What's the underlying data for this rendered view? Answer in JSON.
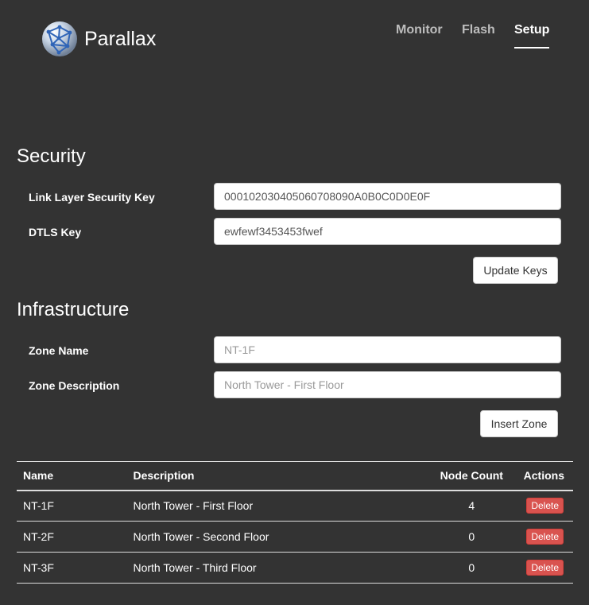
{
  "app": {
    "brand": "Parallax",
    "logo_icon": "globe-network-icon"
  },
  "nav": {
    "items": [
      {
        "label": "Monitor",
        "active": false
      },
      {
        "label": "Flash",
        "active": false
      },
      {
        "label": "Setup",
        "active": true
      }
    ]
  },
  "security": {
    "title": "Security",
    "link_layer_key_label": "Link Layer Security Key",
    "link_layer_key_value": "000102030405060708090A0B0C0D0E0F",
    "dtls_key_label": "DTLS Key",
    "dtls_key_value": "ewfewf3453453fwef",
    "update_button": "Update Keys"
  },
  "infrastructure": {
    "title": "Infrastructure",
    "zone_name_label": "Zone Name",
    "zone_name_placeholder": "NT-1F",
    "zone_description_label": "Zone Description",
    "zone_description_placeholder": "North Tower - First Floor",
    "insert_button": "Insert Zone"
  },
  "zones_table": {
    "headers": {
      "name": "Name",
      "description": "Description",
      "node_count": "Node Count",
      "actions": "Actions"
    },
    "rows": [
      {
        "name": "NT-1F",
        "description": "North Tower - First Floor",
        "node_count": "4",
        "action": "Delete"
      },
      {
        "name": "NT-2F",
        "description": "North Tower - Second Floor",
        "node_count": "0",
        "action": "Delete"
      },
      {
        "name": "NT-3F",
        "description": "North Tower - Third Floor",
        "node_count": "0",
        "action": "Delete"
      }
    ]
  },
  "colors": {
    "background": "#333333",
    "danger": "#d9534f",
    "text": "#ffffff",
    "nav_inactive": "#bdbdbd"
  }
}
